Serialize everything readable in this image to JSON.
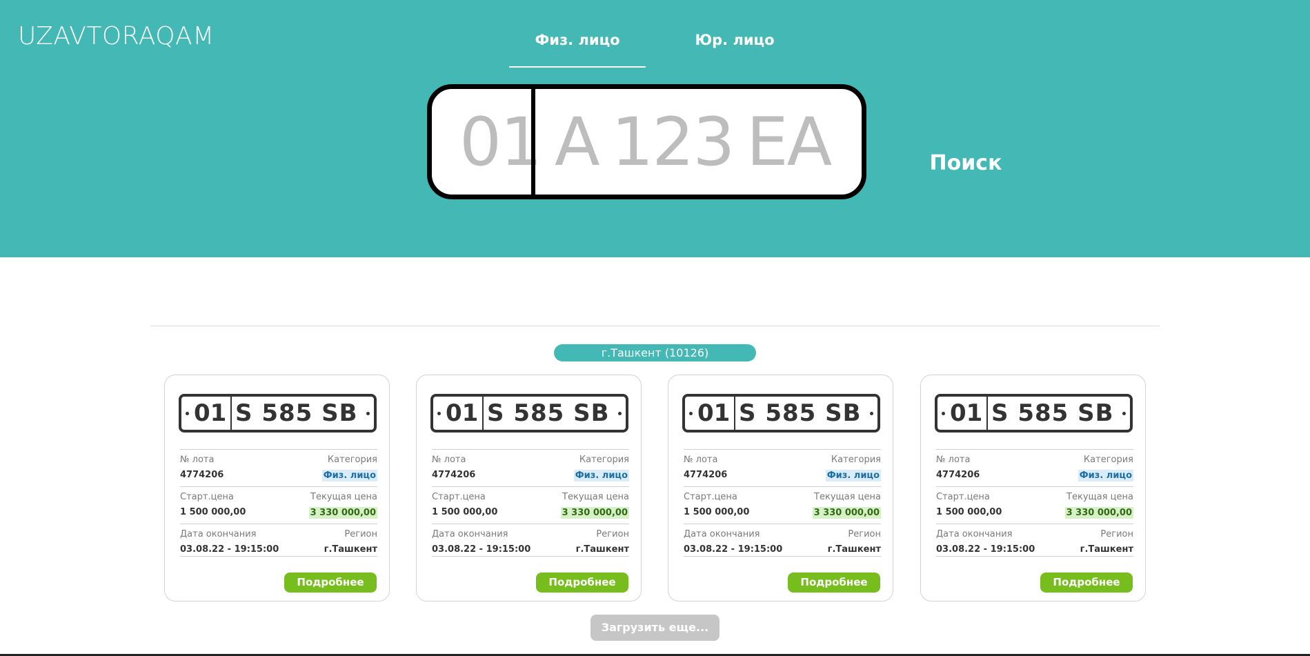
{
  "header": {
    "logo": "UZAVTORAQAM",
    "tabs": [
      {
        "label": "Физ. лицо",
        "active": true
      },
      {
        "label": "Юр. лицо",
        "active": false
      }
    ],
    "plate_input": {
      "region_placeholder": "01",
      "number_placeholder": "A 123 EA"
    },
    "search_label": "Поиск",
    "background_color": "#43b8b5"
  },
  "filter": {
    "city_pill": "г.Ташкент (10126)"
  },
  "lots": [
    {
      "plate_region": "01",
      "plate_number": "S 585 SB",
      "lot_label": "№ лота",
      "lot_value": "4774206",
      "category_label": "Категория",
      "category_value": "Физ. лицо",
      "start_price_label": "Старт.цена",
      "start_price_value": "1 500 000,00",
      "current_price_label": "Текущая цена",
      "current_price_value": "3 330 000,00",
      "end_date_label": "Дата окончания",
      "end_date_value": "03.08.22 - 19:15:00",
      "region_label": "Регион",
      "region_value": "г.Ташкент",
      "more_button": "Подробнее"
    },
    {
      "plate_region": "01",
      "plate_number": "S 585 SB",
      "lot_label": "№ лота",
      "lot_value": "4774206",
      "category_label": "Категория",
      "category_value": "Физ. лицо",
      "start_price_label": "Старт.цена",
      "start_price_value": "1 500 000,00",
      "current_price_label": "Текущая цена",
      "current_price_value": "3 330 000,00",
      "end_date_label": "Дата окончания",
      "end_date_value": "03.08.22 - 19:15:00",
      "region_label": "Регион",
      "region_value": "г.Ташкент",
      "more_button": "Подробнее"
    },
    {
      "plate_region": "01",
      "plate_number": "S 585 SB",
      "lot_label": "№ лота",
      "lot_value": "4774206",
      "category_label": "Категория",
      "category_value": "Физ. лицо",
      "start_price_label": "Старт.цена",
      "start_price_value": "1 500 000,00",
      "current_price_label": "Текущая цена",
      "current_price_value": "3 330 000,00",
      "end_date_label": "Дата окончания",
      "end_date_value": "03.08.22 - 19:15:00",
      "region_label": "Регион",
      "region_value": "г.Ташкент",
      "more_button": "Подробнее"
    },
    {
      "plate_region": "01",
      "plate_number": "S 585 SB",
      "lot_label": "№ лота",
      "lot_value": "4774206",
      "category_label": "Категория",
      "category_value": "Физ. лицо",
      "start_price_label": "Старт.цена",
      "start_price_value": "1 500 000,00",
      "current_price_label": "Текущая цена",
      "current_price_value": "3 330 000,00",
      "end_date_label": "Дата окончания",
      "end_date_value": "03.08.22 - 19:15:00",
      "region_label": "Регион",
      "region_value": "г.Ташкент",
      "more_button": "Подробнее"
    }
  ],
  "load_more_label": "Загрузить еще...",
  "colors": {
    "accent": "#43b8b5",
    "button_green": "#76bd1d",
    "button_disabled": "#c6c6c6"
  }
}
